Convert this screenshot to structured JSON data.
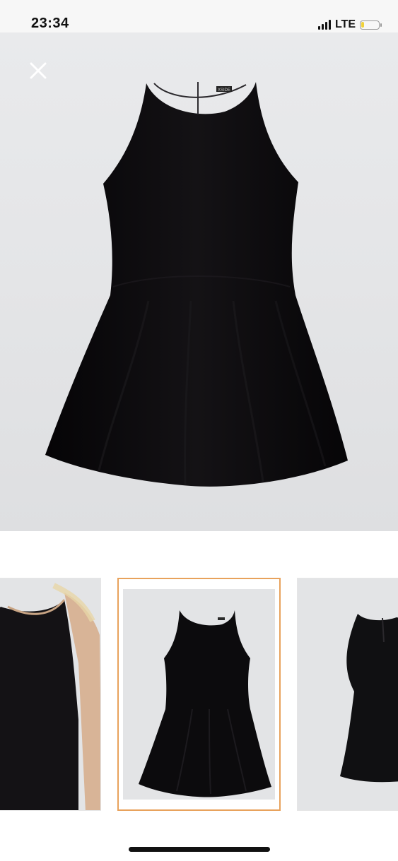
{
  "status_bar": {
    "time": "23:34",
    "network": "LTE",
    "battery_level": 0.2,
    "signal_icon": "signal-bars-icon",
    "battery_icon": "battery-icon"
  },
  "viewer": {
    "close_icon": "close-icon",
    "brand_label": "XSIDE"
  },
  "thumbnails": [
    {
      "name": "model-wearing-dress",
      "selected": false
    },
    {
      "name": "dress-front-flat",
      "selected": true
    },
    {
      "name": "dress-back-flat",
      "selected": false
    }
  ],
  "colors": {
    "selected_border": "#e8a25c",
    "dress": "#0b0a0c",
    "backdrop": "#e4e5e7"
  }
}
